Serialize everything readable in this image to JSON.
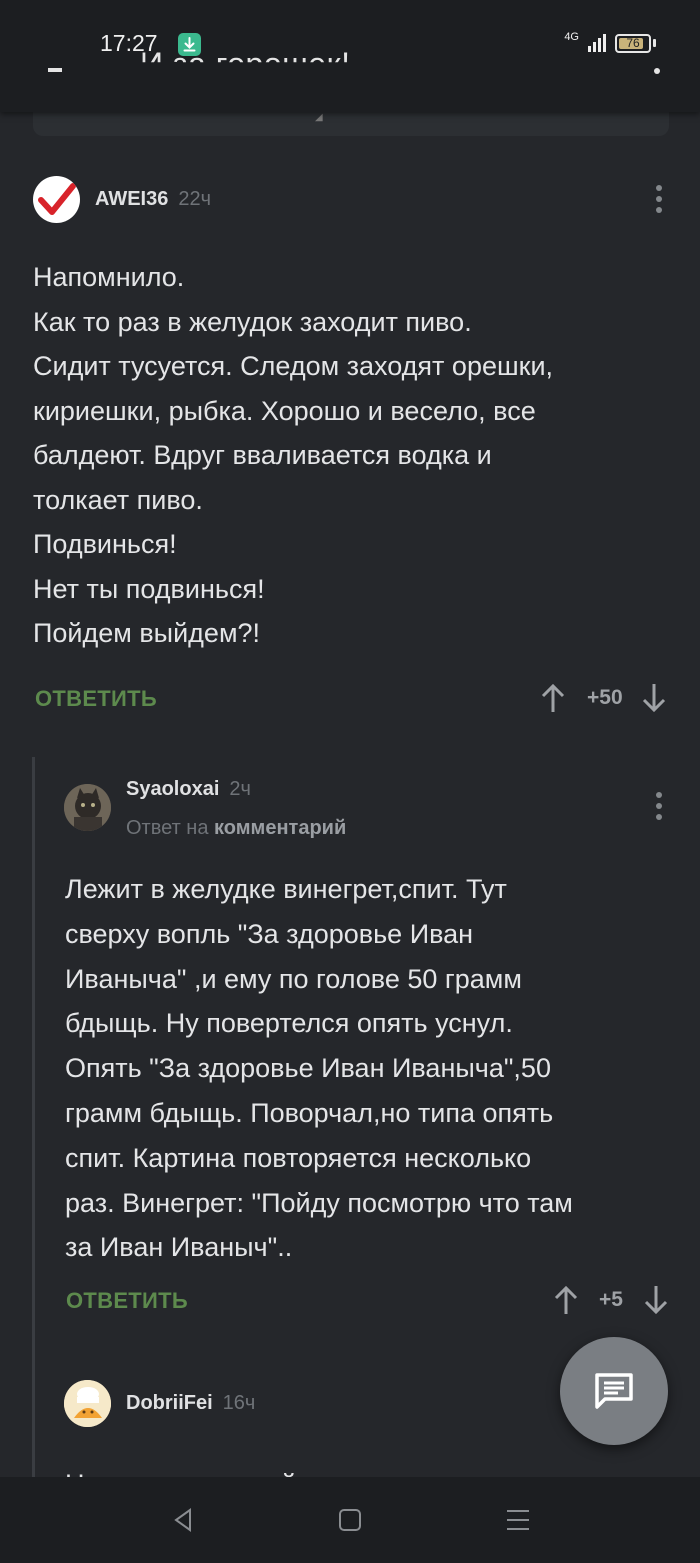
{
  "status_bar": {
    "time": "17:27",
    "network": "4G",
    "battery": "76",
    "battery_level": 0.76
  },
  "header": {
    "title_partial": "И за горошек!"
  },
  "comments": [
    {
      "username": "AWEI36",
      "time": "22ч",
      "text": "Напомнило.\nКак то раз в желудок заходит пиво.\nСидит тусуется. Следом заходят орешки,\nкириешки, рыбка. Хорошо и весело, все\nбалдеют. Вдруг вваливается водка и\nтолкает пиво.\nПодвинься!\nНет ты подвинься!\nПойдем выйдем?!",
      "reply_label": "ОТВЕТИТЬ",
      "score": "+50"
    },
    {
      "username": "Syaoloxai",
      "time": "2ч",
      "reply_to_prefix": "Ответ на",
      "reply_to_target": "комментарий",
      "text": "Лежит в желудке винегрет,спит. Тут\nсверху вопль \"За здоровье Иван\nИваныча\" ,и ему по голове 50 грамм\nбдыщь. Ну повертелся опять уснул.\nОпять \"За здоровье Иван Иваныча\",50\nграмм бдыщь. Поворчал,но типа опять\nспит. Картина повторяется несколько\nраз. Винегрет: \"Пойду посмотрю что там\nза Иван Иваныч\"..",
      "reply_label": "ОТВЕТИТЬ",
      "score": "+5"
    },
    {
      "username": "DobriiFei",
      "time": "16ч",
      "text_partial": "Никогда не мешайте водку с пивом"
    }
  ],
  "icons": {
    "download": "download-icon",
    "comment_fab": "comment-icon",
    "nav_back": "back-triangle-icon",
    "nav_home": "home-square-icon",
    "nav_menu": "menu-lines-icon"
  },
  "colors": {
    "background": "#25272b",
    "reply_green": "#5d8a4d",
    "avatar_check": "#d8232a"
  }
}
